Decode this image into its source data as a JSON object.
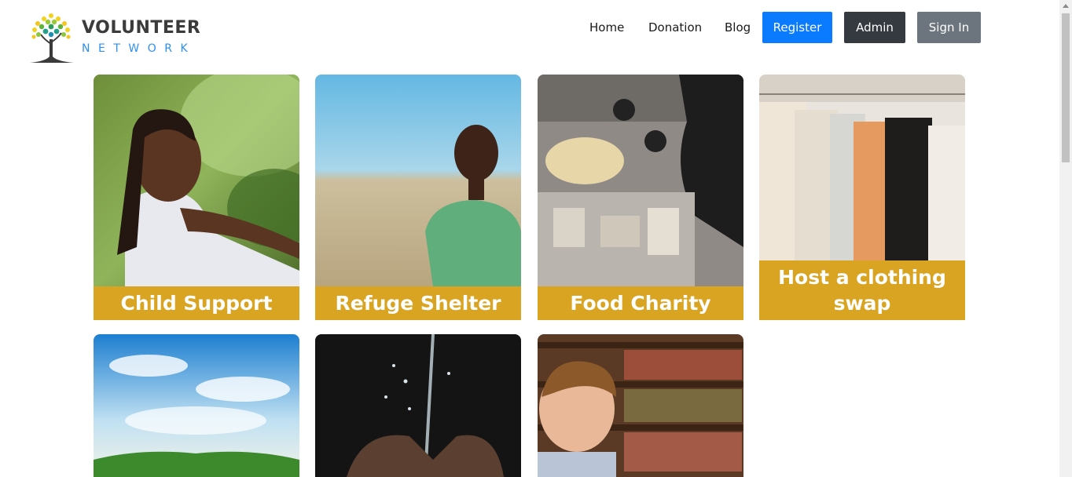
{
  "brand": {
    "title": "VOLUNTEER",
    "subtitle": "NETWORK"
  },
  "nav": {
    "home": "Home",
    "donation": "Donation",
    "blog": "Blog",
    "register": "Register",
    "admin": "Admin",
    "sign_in": "Sign In"
  },
  "colors": {
    "register": "#0a7bff",
    "admin": "#343a40",
    "sign_in": "#6c757d",
    "card_label": "#d9a421",
    "logo_blue": "#2f8ff0"
  },
  "cards": [
    {
      "title": "Child Support",
      "image": "girl-outdoors-photo"
    },
    {
      "title": "Refuge Shelter",
      "image": "boy-in-field-photo"
    },
    {
      "title": "Food Charity",
      "image": "food-donation-photo"
    },
    {
      "title": "Host a clothing swap",
      "image": "clothing-rack-photo"
    },
    {
      "title": "",
      "image": "sky-landscape-photo"
    },
    {
      "title": "",
      "image": "water-hands-photo"
    },
    {
      "title": "",
      "image": "boy-library-photo"
    }
  ]
}
